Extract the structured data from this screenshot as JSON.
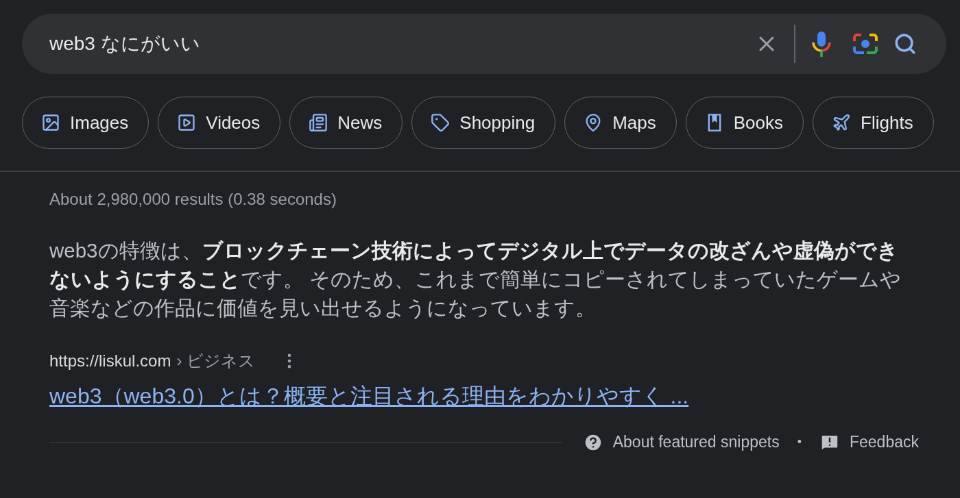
{
  "search": {
    "value": "web3 なにがいい"
  },
  "chips": [
    {
      "kind": "images",
      "label": "Images"
    },
    {
      "kind": "videos",
      "label": "Videos"
    },
    {
      "kind": "news",
      "label": "News"
    },
    {
      "kind": "shopping",
      "label": "Shopping"
    },
    {
      "kind": "maps",
      "label": "Maps"
    },
    {
      "kind": "books",
      "label": "Books"
    },
    {
      "kind": "flights",
      "label": "Flights"
    }
  ],
  "result_stats": "About 2,980,000 results (0.38 seconds)",
  "snippet": {
    "text": "web3の特徴は、**ブロックチェーン技術によってデジタル上でデータの改ざんや虚偽ができないようにすること**です。 そのため、これまで簡単にコピーされてしまっていたゲームや音楽などの作品に価値を見い出せるようになっています。",
    "source_url": "https://liskul.com",
    "breadcrumb": "› ビジネス",
    "title": "web3（web3.0）とは？概要と注目される理由をわかりやすく ..."
  },
  "footer": {
    "about": "About featured snippets",
    "separator": "•",
    "feedback": "Feedback"
  }
}
